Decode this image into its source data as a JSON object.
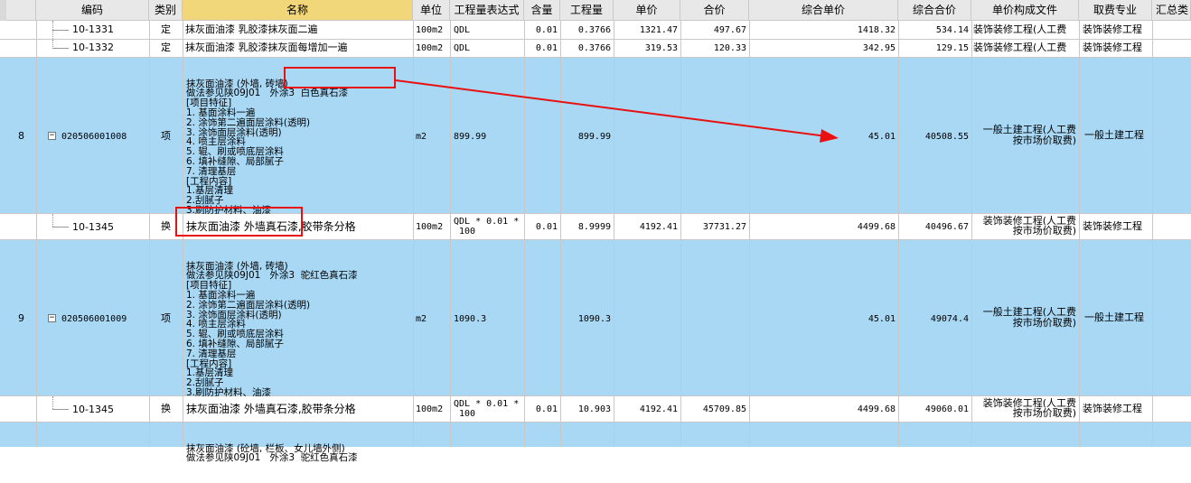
{
  "columns": {
    "code": "编码",
    "type": "类别",
    "name": "名称",
    "unit": "单位",
    "expr": "工程量表达式",
    "content": "含量",
    "qty": "工程量",
    "price": "单价",
    "total": "合价",
    "comp_price": "综合单价",
    "comp_total": "综合合价",
    "file": "单价构成文件",
    "fee": "取费专业",
    "sum": "汇总类"
  },
  "rows": [
    {
      "code": "10-1331",
      "type": "定",
      "name": "抹灰面油漆 乳胶漆抹灰面二遍",
      "unit": "100m2",
      "expr": "QDL",
      "content": "0.01",
      "qty": "0.3766",
      "price": "1321.47",
      "total": "497.67",
      "comp_price": "1418.32",
      "comp_total": "534.14",
      "file": "装饰装修工程(人工费",
      "fee": "装饰装修工程"
    },
    {
      "code": "10-1332",
      "type": "定",
      "name": "抹灰面油漆 乳胶漆抹灰面每增加一遍",
      "unit": "100m2",
      "expr": "QDL",
      "content": "0.01",
      "qty": "0.3766",
      "price": "319.53",
      "total": "120.33",
      "comp_price": "342.95",
      "comp_total": "129.15",
      "file": "装饰装修工程(人工费",
      "fee": "装饰装修工程"
    },
    {
      "num": "8",
      "code": "020506001008",
      "type": "项",
      "unit": "m2",
      "expr": "899.99",
      "qty": "899.99",
      "comp_price": "45.01",
      "comp_total": "40508.55",
      "file1": "一般土建工程(人工费",
      "file2": "按市场价取费)",
      "fee": "一般土建工程",
      "desc": [
        "抹灰面油漆 (外墙, 砖墙)",
        "做法参见陕09J01   外涂3  白色真石漆",
        "[项目特征]",
        "1. 基面涂料一遍",
        "2. 涂饰第二遍面层涂料(透明)",
        "3. 涂饰面层涂料(透明)",
        "4. 喷主层涂料",
        "5. 辊、刷或喷底层涂料",
        "6. 填补缝隙、局部腻子",
        "7. 清理基层",
        "[工程内容]",
        "1.基层清理",
        "2.刮腻子",
        "3.刷防护材料、油漆"
      ]
    },
    {
      "code": "10-1345",
      "type": "换",
      "name": "抹灰面油漆 外墙真石漆,胶带条分格",
      "unit": "100m2",
      "expr1": "QDL * 0.01 *",
      "expr2": "100",
      "content": "0.01",
      "qty": "8.9999",
      "price": "4192.41",
      "total": "37731.27",
      "comp_price": "4499.68",
      "comp_total": "40496.67",
      "file1": "装饰装修工程(人工费",
      "file2": "按市场价取费)",
      "fee": "装饰装修工程"
    },
    {
      "num": "9",
      "code": "020506001009",
      "type": "项",
      "unit": "m2",
      "expr": "1090.3",
      "qty": "1090.3",
      "comp_price": "45.01",
      "comp_total": "49074.4",
      "file1": "一般土建工程(人工费",
      "file2": "按市场价取费)",
      "fee": "一般土建工程",
      "desc": [
        "抹灰面油漆 (外墙, 砖墙)",
        "做法参见陕09J01   外涂3  驼红色真石漆",
        "[项目特征]",
        "1. 基面涂料一遍",
        "2. 涂饰第二遍面层涂料(透明)",
        "3. 涂饰面层涂料(透明)",
        "4. 喷主层涂料",
        "5. 辊、刷或喷底层涂料",
        "6. 填补缝隙、局部腻子",
        "7. 清理基层",
        "[工程内容]",
        "1.基层清理",
        "2.刮腻子",
        "3.刷防护材料、油漆"
      ]
    },
    {
      "code": "10-1345",
      "type": "换",
      "name": "抹灰面油漆 外墙真石漆,胶带条分格",
      "unit": "100m2",
      "expr1": "QDL * 0.01 *",
      "expr2": "100",
      "content": "0.01",
      "qty": "10.903",
      "price": "4192.41",
      "total": "45709.85",
      "comp_price": "4499.68",
      "comp_total": "49060.01",
      "file1": "装饰装修工程(人工费",
      "file2": "按市场价取费)",
      "fee": "装饰装修工程"
    },
    {
      "desc": [
        "抹灰面油漆 (砼墙, 栏板、女儿墙外侧)",
        "做法参见陕09J01   外涂3  驼红色真石漆"
      ]
    }
  ],
  "colors": {
    "selected_row": "#a9d8f5",
    "header": "#e8e8e8",
    "name_header": "#f2d77a",
    "annotation": "#e81010"
  }
}
